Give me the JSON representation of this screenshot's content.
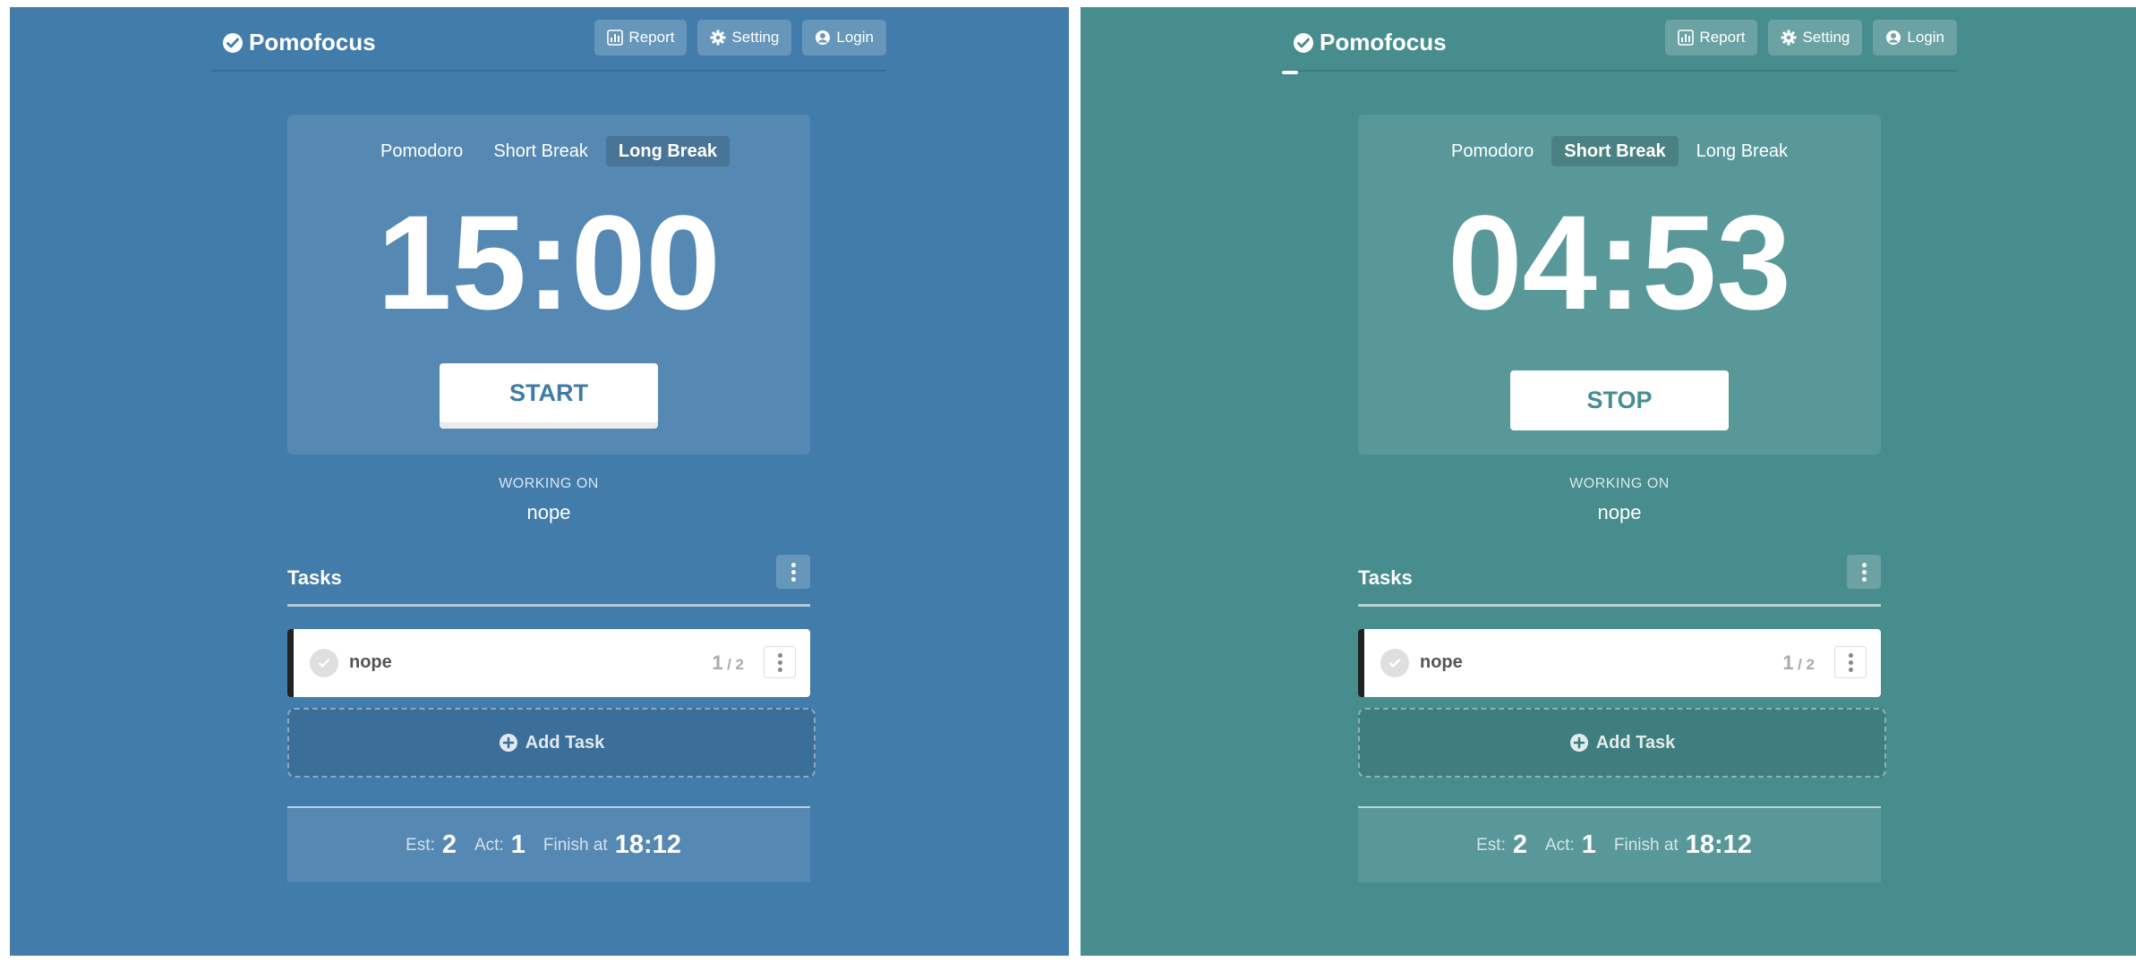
{
  "colors": {
    "left_panel_bg": "#427cab",
    "right_panel_bg": "#478d8e"
  },
  "panels": [
    {
      "brand": "Pomofocus",
      "nav": {
        "report": "Report",
        "setting": "Setting",
        "login": "Login"
      },
      "modes": [
        "Pomodoro",
        "Short Break",
        "Long Break"
      ],
      "active_mode": "Long Break",
      "timer": "15:00",
      "action_button": "START",
      "working_on_label": "WORKING ON",
      "working_on_task": "nope",
      "tasks_title": "Tasks",
      "task": {
        "name": "nope",
        "act": "1",
        "est": "/ 2"
      },
      "add_task": "Add Task",
      "summary": {
        "est_label": "Est:",
        "est": "2",
        "act_label": "Act:",
        "act": "1",
        "finish_label": "Finish at",
        "finish": "18:12"
      }
    },
    {
      "brand": "Pomofocus",
      "nav": {
        "report": "Report",
        "setting": "Setting",
        "login": "Login"
      },
      "modes": [
        "Pomodoro",
        "Short Break",
        "Long Break"
      ],
      "active_mode": "Short Break",
      "timer": "04:53",
      "action_button": "STOP",
      "working_on_label": "WORKING ON",
      "working_on_task": "nope",
      "tasks_title": "Tasks",
      "task": {
        "name": "nope",
        "act": "1",
        "est": "/ 2"
      },
      "add_task": "Add Task",
      "summary": {
        "est_label": "Est:",
        "est": "2",
        "act_label": "Act:",
        "act": "1",
        "finish_label": "Finish at",
        "finish": "18:12"
      }
    }
  ]
}
